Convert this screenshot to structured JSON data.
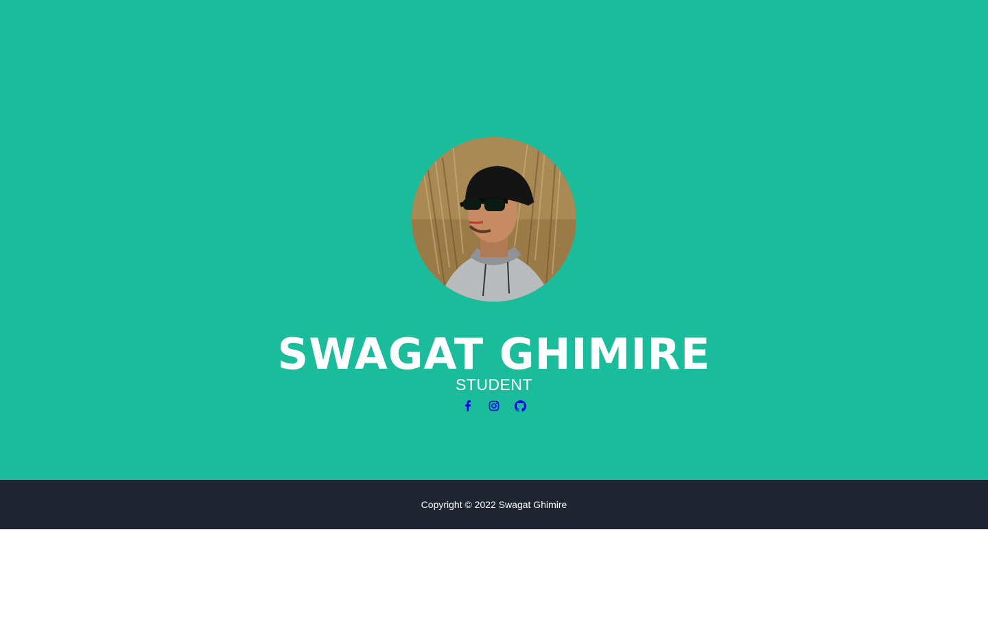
{
  "profile": {
    "name": "SWAGAT GHIMIRE",
    "role": "STUDENT",
    "avatar": "profile-photo"
  },
  "social_links": [
    {
      "icon": "facebook-icon"
    },
    {
      "icon": "instagram-icon"
    },
    {
      "icon": "github-icon"
    }
  ],
  "footer": {
    "copyright": "Copyright © 2022 Swagat Ghimire"
  },
  "colors": {
    "hero_background": "#1abc9c",
    "footer_background": "#1e2430",
    "text": "#ffffff",
    "icon": "#0000ee",
    "page_background": "#ffffff"
  }
}
